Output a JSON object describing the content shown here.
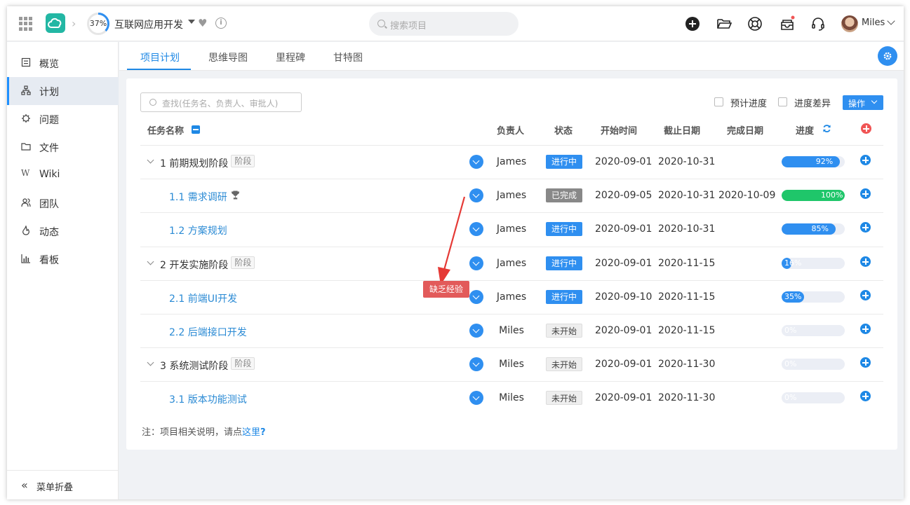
{
  "header": {
    "progress": "37%",
    "progress_value": 37,
    "project_title": "互联网应用开发",
    "search_placeholder": "搜索项目",
    "user_name": "Miles"
  },
  "sidebar": {
    "items": [
      {
        "label": "概览",
        "icon": "overview-icon"
      },
      {
        "label": "计划",
        "icon": "plan-icon"
      },
      {
        "label": "问题",
        "icon": "issue-icon"
      },
      {
        "label": "文件",
        "icon": "folder-icon"
      },
      {
        "label": "Wiki",
        "icon": "wiki-icon"
      },
      {
        "label": "团队",
        "icon": "team-icon"
      },
      {
        "label": "动态",
        "icon": "activity-icon"
      },
      {
        "label": "看板",
        "icon": "board-icon"
      }
    ],
    "collapse_label": "菜单折叠"
  },
  "tabs": [
    "项目计划",
    "思维导图",
    "里程碑",
    "甘特图"
  ],
  "toolbar": {
    "filter_placeholder": "查找(任务名、负责人、审批人)",
    "planned_progress": "预计进度",
    "progress_diff": "进度差异",
    "operate": "操作"
  },
  "columns": {
    "name": "任务名称",
    "owner": "负责人",
    "status": "状态",
    "start": "开始时间",
    "deadline": "截止日期",
    "finished": "完成日期",
    "progress": "进度"
  },
  "stage_tag": "阶段",
  "rows": [
    {
      "name": "1 前期规划阶段",
      "stage": true,
      "owner": "James",
      "status": "进行中",
      "start": "2020-09-01",
      "deadline": "2020-10-31",
      "finished": "",
      "progress": "92%",
      "pv": 92
    },
    {
      "name": "1.1 需求调研",
      "sub": true,
      "trophy": true,
      "owner": "James",
      "status": "已完成",
      "start": "2020-09-05",
      "deadline": "2020-10-31",
      "finished": "2020-10-09",
      "progress": "100%",
      "pv": 100
    },
    {
      "name": "1.2 方案规划",
      "sub": true,
      "owner": "James",
      "status": "进行中",
      "start": "2020-09-01",
      "deadline": "2020-10-31",
      "finished": "",
      "progress": "85%",
      "pv": 85
    },
    {
      "name": "2 开发实施阶段",
      "stage": true,
      "owner": "James",
      "status": "进行中",
      "start": "2020-09-01",
      "deadline": "2020-11-15",
      "finished": "",
      "progress": "16%",
      "pv": 16
    },
    {
      "name": "2.1 前端UI开发",
      "sub": true,
      "owner": "James",
      "status": "进行中",
      "start": "2020-09-10",
      "deadline": "2020-11-15",
      "finished": "",
      "progress": "35%",
      "pv": 35
    },
    {
      "name": "2.2 后端接口开发",
      "sub": true,
      "owner": "Miles",
      "status": "未开始",
      "start": "2020-09-01",
      "deadline": "2020-11-15",
      "finished": "",
      "progress": "0%",
      "pv": 0
    },
    {
      "name": "3 系统测试阶段",
      "stage": true,
      "owner": "Miles",
      "status": "未开始",
      "start": "2020-09-01",
      "deadline": "2020-11-30",
      "finished": "",
      "progress": "0%",
      "pv": 0
    },
    {
      "name": "3.1 版本功能测试",
      "sub": true,
      "owner": "Miles",
      "status": "未开始",
      "start": "2020-09-01",
      "deadline": "2020-11-30",
      "finished": "",
      "progress": "0%",
      "pv": 0
    }
  ],
  "annotation": "缺乏经验",
  "footnote": {
    "text": "注：项目相关说明，请点",
    "link": "这里",
    "mark": "?"
  },
  "colors": {
    "accent": "#2f8ff0",
    "done": "#1fc66a",
    "warn": "#e25a5a",
    "logo": "#23b7a4"
  }
}
